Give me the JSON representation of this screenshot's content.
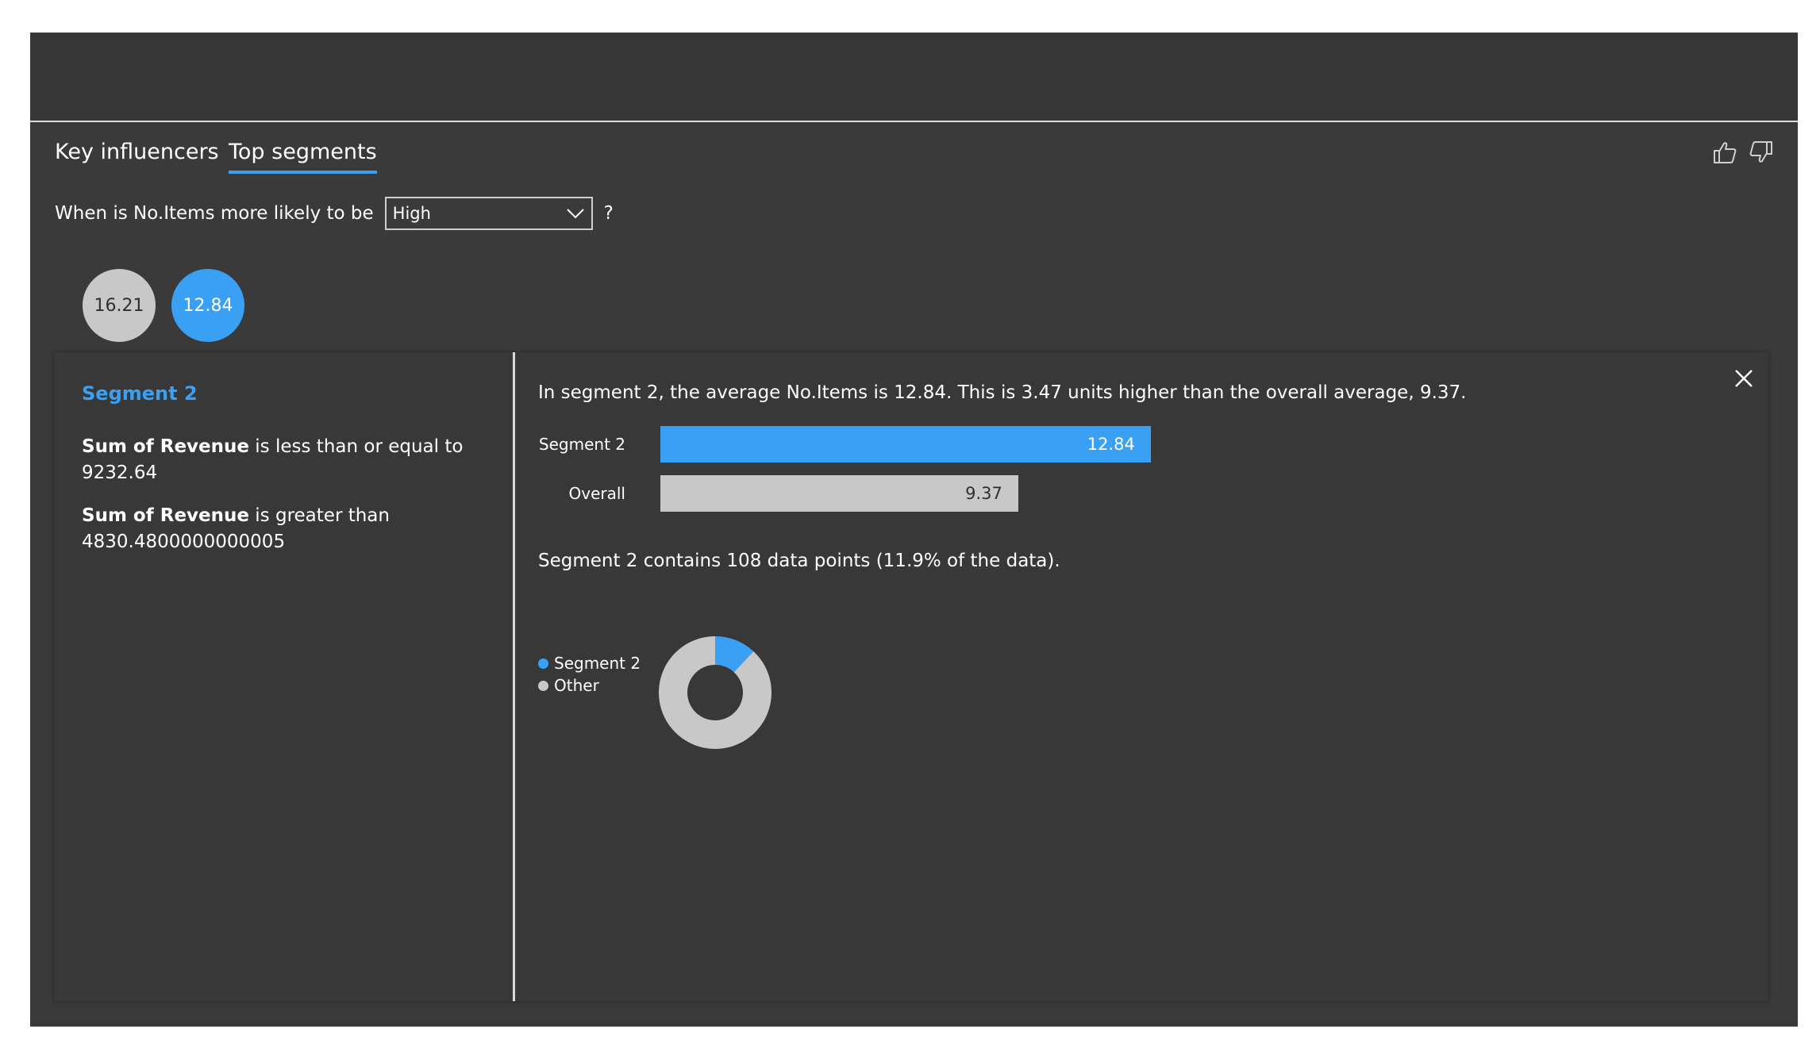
{
  "colors": {
    "accent": "#3aa0f3",
    "other": "#c8c8c8",
    "background": "#3a3a3a"
  },
  "tabs": [
    {
      "label": "Key influencers",
      "active": false
    },
    {
      "label": "Top segments",
      "active": true
    }
  ],
  "toolbar": {
    "icons": [
      "thumbs-up-icon",
      "thumbs-down-icon"
    ]
  },
  "question": {
    "prefix": "When is No.Items more likely to be",
    "selected": "High",
    "suffix": "?"
  },
  "bubbles": [
    "16.21",
    "12.84"
  ],
  "segment": {
    "title": "Segment 2",
    "conditions": [
      {
        "field": "Sum of Revenue",
        "text": " is less than or equal to 9232.64"
      },
      {
        "field": "Sum of Revenue",
        "text": " is greater than 4830.4800000000005"
      }
    ],
    "summary": "In segment 2, the average No.Items is 12.84. This is 3.47 units higher than the overall average, 9.37.",
    "share_text": "Segment 2 contains 108 data points (11.9% of the data)."
  },
  "chart_data": [
    {
      "type": "bar",
      "categories": [
        "Segment 2",
        "Overall"
      ],
      "values": [
        12.84,
        9.37
      ],
      "value_labels": [
        "12.84",
        "9.37"
      ],
      "xlim": [
        0,
        16.21
      ]
    },
    {
      "type": "pie",
      "donut": true,
      "labels": [
        "Segment 2",
        "Other"
      ],
      "values": [
        11.9,
        88.1
      ],
      "legend": "left"
    }
  ]
}
